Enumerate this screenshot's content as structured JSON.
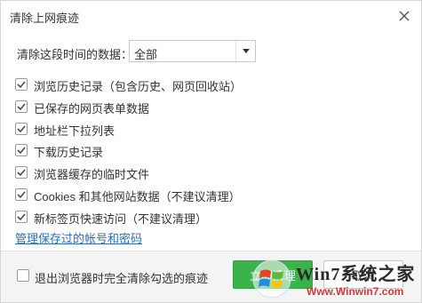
{
  "dialog": {
    "title": "清除上网痕迹",
    "close_icon": "close-icon"
  },
  "range": {
    "label": "清除这段时间的数据：",
    "selected": "全部"
  },
  "options": [
    {
      "label": "浏览历史记录（包含历史、网页回收站）",
      "checked": true
    },
    {
      "label": "已保存的网页表单数据",
      "checked": true
    },
    {
      "label": "地址栏下拉列表",
      "checked": true
    },
    {
      "label": "下载历史记录",
      "checked": true
    },
    {
      "label": "浏览器缓存的临时文件",
      "checked": true
    },
    {
      "label": "Cookies 和其他网站数据（不建议清理）",
      "checked": true
    },
    {
      "label": "新标签页快速访问（不建议清理）",
      "checked": true
    }
  ],
  "manage_link": "管理保存过的帐号和密码",
  "footer": {
    "exit_clear_label": "退出浏览器时完全清除勾选的痕迹",
    "exit_clear_checked": false,
    "primary_label": "立即清理",
    "secondary_label": "取消"
  },
  "watermark": {
    "brand": "Win7系统之家",
    "url": "Www.Winwin7.com"
  },
  "colors": {
    "accent_green": "#3cb34a",
    "link_blue": "#2c6ebf",
    "check_gray": "#4a4a4a"
  }
}
